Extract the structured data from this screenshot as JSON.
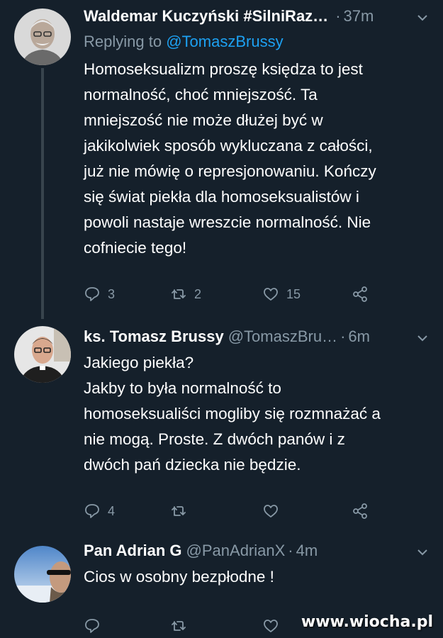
{
  "tweets": [
    {
      "name": "Waldemar Kuczyński #SilniRaz…",
      "handle": "",
      "time": "37m",
      "reply_label": "Replying to",
      "reply_mention": "@TomaszBrussy",
      "text": "Homoseksualizm proszę księdza to jest\nnormalność, choć mniejszość. Ta\nmniejszość nie może dłużej być w\njakikolwiek sposób wykluczana z całości,\njuż nie mówię o represjonowaniu. Kończy\nsię świat piekła dla homoseksualistów i\npowoli nastaje wreszcie normalność. Nie\ncofniecie tego!",
      "replies": "3",
      "retweets": "2",
      "likes": "15"
    },
    {
      "name": "ks. Tomasz Brussy",
      "handle": "@TomaszBru…",
      "time": "6m",
      "text": "Jakiego piekła?\nJakby to była normalność to\nhomoseksualiści mogliby się rozmnażać a\nnie mogą. Proste. Z dwóch panów i z\ndwóch pań dziecka nie będzie.",
      "replies": "4",
      "retweets": "",
      "likes": ""
    },
    {
      "name": "Pan Adrian G",
      "handle": "@PanAdrianX",
      "time": "4m",
      "text": "Cios w osobny bezpłodne !",
      "replies": "",
      "retweets": "",
      "likes": ""
    }
  ],
  "separator": "·",
  "watermark": "www.wiocha.pl",
  "colors": {
    "background": "#15202b",
    "text": "#ffffff",
    "secondary": "#8899a6",
    "link": "#1da1f2",
    "thread_line": "#38444d"
  },
  "icons": [
    "reply-icon",
    "retweet-icon",
    "like-icon",
    "share-icon",
    "chevron-down-icon"
  ]
}
